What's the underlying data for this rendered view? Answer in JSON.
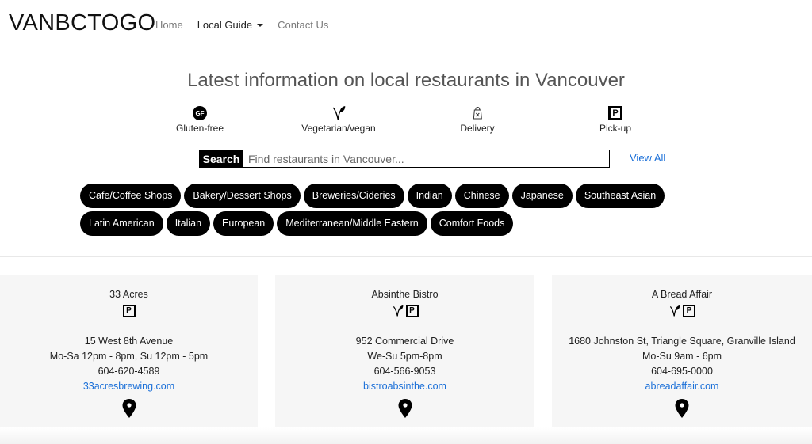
{
  "navbar": {
    "brand": "VANBCTOGO",
    "links": [
      {
        "label": "Home",
        "active": false
      },
      {
        "label": "Local Guide",
        "active": true,
        "dropdown": true
      },
      {
        "label": "Contact Us",
        "active": false
      }
    ]
  },
  "hero": {
    "title": "Latest information on local restaurants in Vancouver"
  },
  "legend": [
    {
      "icon": "gluten-free-icon",
      "icon_text": "GF",
      "label": "Gluten-free"
    },
    {
      "icon": "leaf-icon",
      "label": "Vegetarian/vegan"
    },
    {
      "icon": "delivery-bag-icon",
      "label": "Delivery"
    },
    {
      "icon": "pickup-icon",
      "icon_text": "P",
      "label": "Pick-up"
    }
  ],
  "search": {
    "label": "Search",
    "placeholder": "Find restaurants in Vancouver...",
    "value": "",
    "view_all": "View All"
  },
  "categories": {
    "row1": [
      "Cafe/Coffee Shops",
      "Bakery/Dessert Shops",
      "Breweries/Cideries",
      "Indian",
      "Chinese",
      "Japanese",
      "Southeast Asian"
    ],
    "row2": [
      "Latin American",
      "Italian",
      "European",
      "Mediterranean/Middle Eastern",
      "Comfort Foods"
    ]
  },
  "restaurants": [
    {
      "name": "33 Acres",
      "icons": [
        "pickup-icon"
      ],
      "address": "15 West 8th Avenue",
      "hours": "Mo-Sa 12pm - 8pm, Su 12pm - 5pm",
      "phone": "604-620-4589",
      "website": "33acresbrewing.com"
    },
    {
      "name": "Absinthe Bistro",
      "icons": [
        "leaf-icon",
        "pickup-icon"
      ],
      "address": "952 Commercial Drive",
      "hours": "We-Su 5pm-8pm",
      "phone": "604-566-9053",
      "website": "bistroabsinthe.com"
    },
    {
      "name": "A Bread Affair",
      "icons": [
        "leaf-icon",
        "pickup-icon"
      ],
      "address": "1680 Johnston St, Triangle Square, Granville Island",
      "hours": "Mo-Su 9am - 6pm",
      "phone": "604-695-0000",
      "website": "abreadaffair.com"
    }
  ],
  "colors": {
    "link": "#1a6fd8",
    "tag_bg": "#000000",
    "card_bg": "#f6f6f6"
  },
  "pickup_letter": "P"
}
